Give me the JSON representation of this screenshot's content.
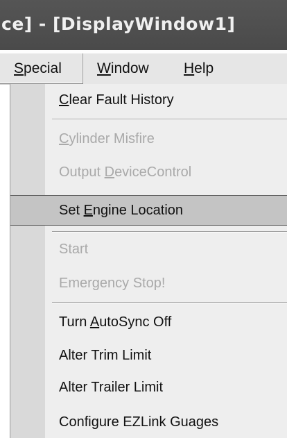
{
  "window": {
    "title": "ce] - [DisplayWindow1]"
  },
  "menubar": {
    "special": {
      "pre": "",
      "key": "S",
      "post": "pecial"
    },
    "window": {
      "pre": "",
      "key": "W",
      "post": "indow"
    },
    "help": {
      "pre": "",
      "key": "H",
      "post": "elp"
    }
  },
  "special_menu": {
    "items": [
      {
        "pre": "",
        "key": "C",
        "post": "lear Fault History",
        "enabled": true
      },
      {
        "pre": "",
        "key": "C",
        "post": "ylinder Misfire",
        "enabled": false
      },
      {
        "pre": "Output ",
        "key": "D",
        "post": "eviceControl",
        "enabled": false
      },
      {
        "pre": "Set ",
        "key": "E",
        "post": "ngine Location",
        "enabled": true,
        "highlighted": true
      },
      {
        "pre": "Start",
        "key": "",
        "post": "",
        "enabled": false
      },
      {
        "pre": "Emergency Stop!",
        "key": "",
        "post": "",
        "enabled": false
      },
      {
        "pre": "Turn ",
        "key": "A",
        "post": "utoSync Off",
        "enabled": true
      },
      {
        "pre": "Alter Trim Limit",
        "key": "",
        "post": "",
        "enabled": true
      },
      {
        "pre": "Alter Trailer Limit",
        "key": "",
        "post": "",
        "enabled": true
      },
      {
        "pre": "Configure EZLink Guages",
        "key": "",
        "post": "",
        "enabled": true
      }
    ]
  }
}
